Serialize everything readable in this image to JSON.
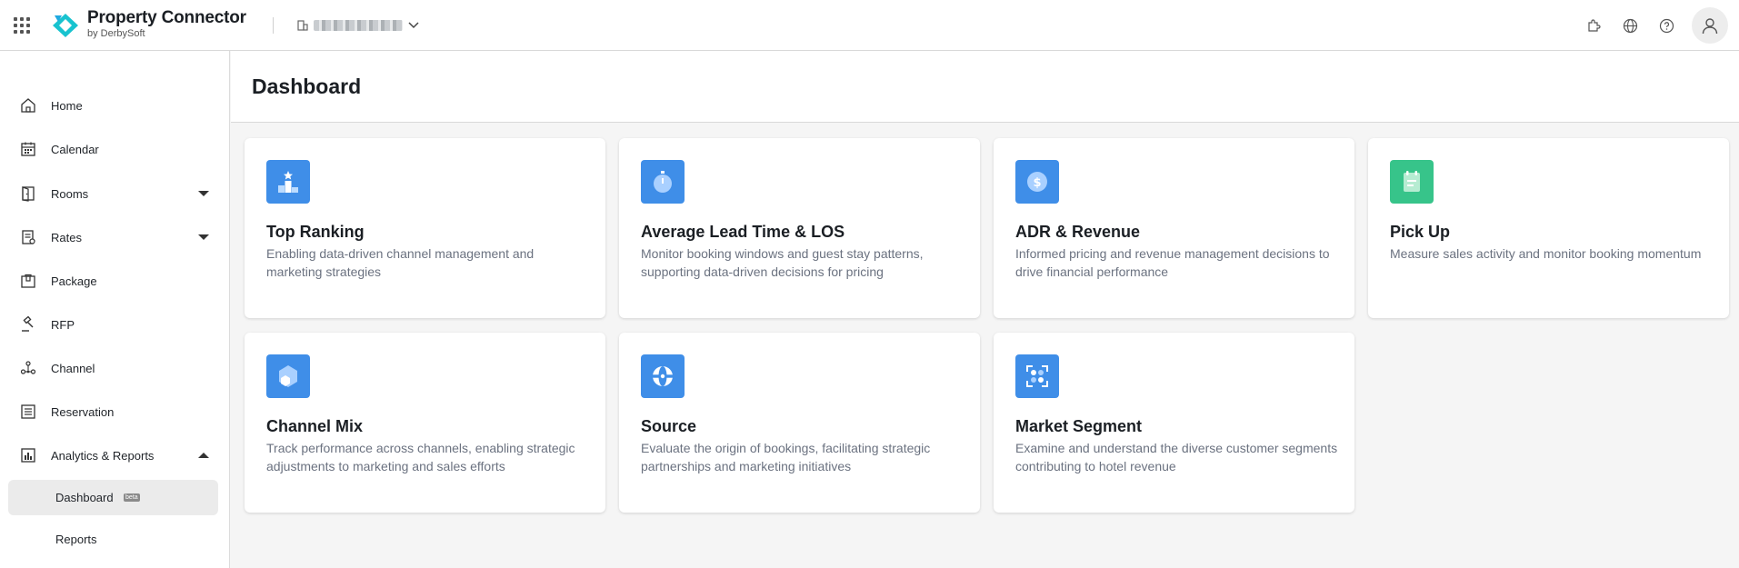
{
  "header": {
    "brand_name": "Property Connector",
    "brand_sub": "by DerbySoft",
    "hotel_name_hidden": true
  },
  "sidebar": {
    "items": [
      {
        "label": "Home",
        "icon": "home-icon"
      },
      {
        "label": "Calendar",
        "icon": "calendar-icon"
      },
      {
        "label": "Rooms",
        "icon": "door-icon",
        "expandable": true
      },
      {
        "label": "Rates",
        "icon": "receipt-icon",
        "expandable": true
      },
      {
        "label": "Package",
        "icon": "package-icon"
      },
      {
        "label": "RFP",
        "icon": "gavel-icon"
      },
      {
        "label": "Channel",
        "icon": "network-icon"
      },
      {
        "label": "Reservation",
        "icon": "list-icon"
      },
      {
        "label": "Analytics & Reports",
        "icon": "chart-icon",
        "expanded": true
      }
    ],
    "sub_items": [
      {
        "label": "Dashboard",
        "active": true,
        "badge": "beta"
      },
      {
        "label": "Reports",
        "active": false
      }
    ]
  },
  "main": {
    "title": "Dashboard",
    "cards": [
      {
        "title": "Top Ranking",
        "desc": "Enabling data-driven channel management and marketing strategies",
        "icon": "podium-icon",
        "color": "#3f8ee8"
      },
      {
        "title": "Average Lead Time & LOS",
        "desc": "Monitor booking windows and guest stay patterns, supporting data-driven decisions for pricing",
        "icon": "stopwatch-icon",
        "color": "#3f8ee8"
      },
      {
        "title": "ADR & Revenue",
        "desc": "Informed pricing and revenue management decisions to drive financial performance",
        "icon": "dollar-coin-icon",
        "color": "#3f8ee8"
      },
      {
        "title": "Pick Up",
        "desc": "Measure sales activity and monitor booking momentum",
        "icon": "clipboard-icon",
        "color": "#37c48a"
      },
      {
        "title": "Channel Mix",
        "desc": "Track performance across channels, enabling strategic adjustments to marketing and sales efforts",
        "icon": "hexagon-icon",
        "color": "#3f8ee8"
      },
      {
        "title": "Source",
        "desc": "Evaluate the origin of bookings, facilitating strategic partnerships and marketing initiatives",
        "icon": "globe-icon",
        "color": "#3f8ee8"
      },
      {
        "title": "Market Segment",
        "desc": "Examine and understand the diverse customer segments contributing to hotel revenue",
        "icon": "segment-scan-icon",
        "color": "#3f8ee8"
      }
    ]
  },
  "colors": {
    "accent_blue": "#3f8ee8",
    "accent_green": "#37c48a",
    "brand_teal": "#18c3cf"
  }
}
